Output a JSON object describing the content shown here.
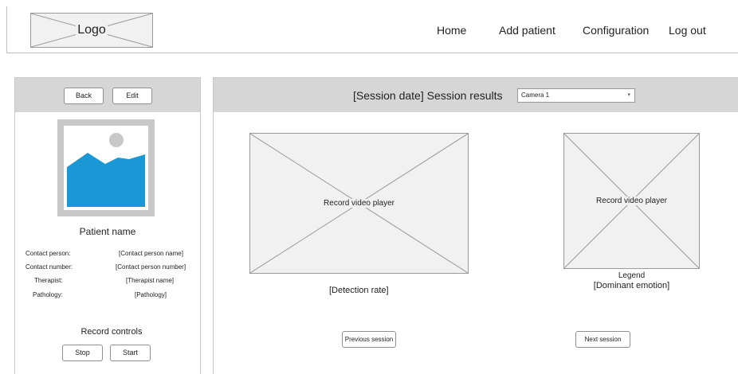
{
  "header": {
    "logo_text": "Logo",
    "nav": [
      "Home",
      "Add patient",
      "Configuration",
      "Log out"
    ]
  },
  "patient_panel": {
    "back_label": "Back",
    "edit_label": "Edit",
    "photo_icon": "image-placeholder-icon",
    "patient_name": "Patient name",
    "details": [
      {
        "label": "Contact person:",
        "value": "[Contact person name]"
      },
      {
        "label": "Contact number:",
        "value": "[Contact person number]"
      },
      {
        "label": "Therapist:",
        "value": "[Therapist name]"
      },
      {
        "label": "Pathology:",
        "value": "[Pathology]"
      }
    ],
    "record_controls_title": "Record controls",
    "stop_label": "Stop",
    "start_label": "Start"
  },
  "session": {
    "title": "[Session date] Session results",
    "camera_selected": "Camera 1",
    "player1_label": "Record video player",
    "player2_label": "Record video player",
    "detection_rate": "[Detection rate]",
    "legend": "Legend",
    "dominant_emotion": "[Dominant emotion]",
    "prev_label": "Previous session",
    "next_label": "Next session"
  },
  "colors": {
    "panel_gray": "#d6d6d6",
    "placeholder_fill": "#f1f1f1",
    "image_blue": "#1a97d5"
  }
}
